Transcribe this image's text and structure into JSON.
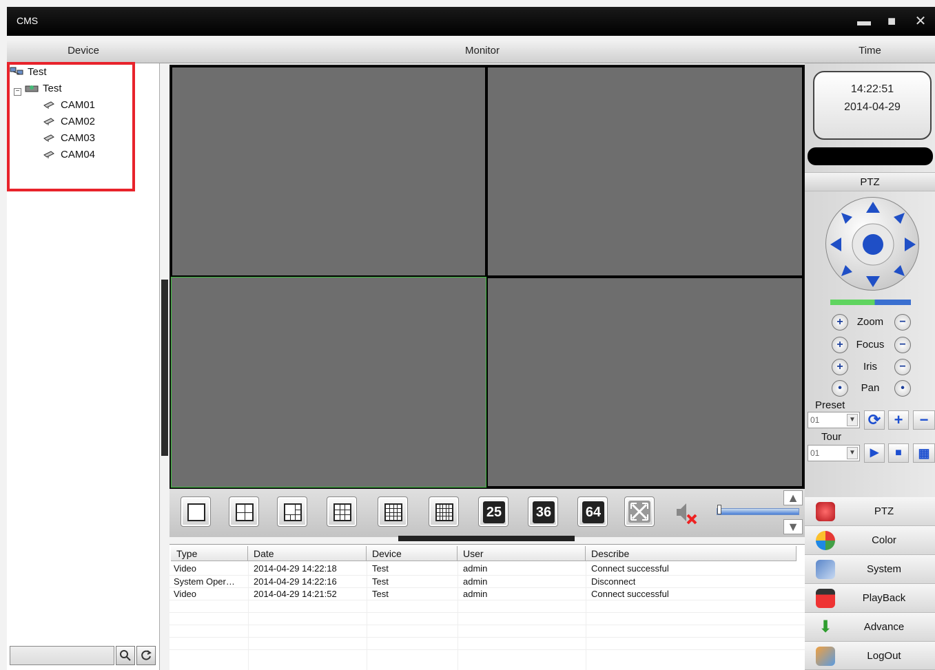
{
  "window": {
    "title": "CMS",
    "minimize": "▬",
    "maximize": "■",
    "close": "✕"
  },
  "header": {
    "device": "Device",
    "monitor": "Monitor",
    "time": "Time"
  },
  "tree": {
    "root": "Test",
    "group": "Test",
    "expander": "−",
    "cameras": [
      "CAM01",
      "CAM02",
      "CAM03",
      "CAM04"
    ]
  },
  "search": {
    "value": "",
    "search_icon": "magnifier-icon",
    "refresh_icon": "refresh-icon"
  },
  "clock": {
    "time": "14:22:51",
    "date": "2014-04-29"
  },
  "ptz": {
    "title": "PTZ",
    "zoom": "Zoom",
    "focus": "Focus",
    "iris": "Iris",
    "pan": "Pan",
    "preset_label": "Preset",
    "preset_value": "01",
    "tour_label": "Tour",
    "tour_value": "01"
  },
  "layout_toolbar": {
    "layouts": [
      "1",
      "4",
      "6",
      "9",
      "16",
      "16b",
      "25",
      "36",
      "64"
    ],
    "n25": "25",
    "n36": "36",
    "n64": "64"
  },
  "log": {
    "columns": [
      "Type",
      "Date",
      "Device",
      "User",
      "Describe"
    ],
    "rows": [
      [
        "Video",
        "2014-04-29 14:22:18",
        "Test",
        "admin",
        "Connect successful"
      ],
      [
        "System Oper…",
        "2014-04-29 14:22:16",
        "Test",
        "admin",
        "Disconnect"
      ],
      [
        "Video",
        "2014-04-29 14:21:52",
        "Test",
        "admin",
        "Connect successful"
      ]
    ]
  },
  "menu": {
    "ptz": "PTZ",
    "color": "Color",
    "system": "System",
    "playback": "PlayBack",
    "advance": "Advance",
    "logout": "LogOut"
  },
  "colors": {
    "selection_border": "#3fc03f",
    "highlight_box": "#e8232b",
    "cell_gray": "#6e6e6e"
  }
}
